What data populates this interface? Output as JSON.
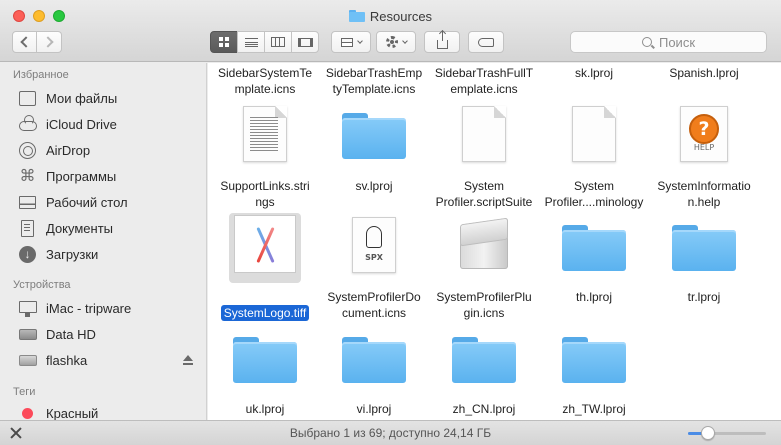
{
  "window": {
    "title": "Resources"
  },
  "toolbar": {
    "search_placeholder": "Поиск",
    "view_modes": [
      "icon-view",
      "list-view",
      "column-view",
      "cover-flow"
    ],
    "active_view": "icon-view"
  },
  "sidebar": {
    "favorites_header": "Избранное",
    "favorites": [
      {
        "label": "Мои файлы",
        "icon": "all-my-files-icon"
      },
      {
        "label": "iCloud Drive",
        "icon": "cloud-icon"
      },
      {
        "label": "AirDrop",
        "icon": "airdrop-icon"
      },
      {
        "label": "Программы",
        "icon": "applications-icon"
      },
      {
        "label": "Рабочий стол",
        "icon": "desktop-icon"
      },
      {
        "label": "Документы",
        "icon": "documents-icon"
      },
      {
        "label": "Загрузки",
        "icon": "downloads-icon"
      }
    ],
    "devices_header": "Устройства",
    "devices": [
      {
        "label": "iMac - tripware",
        "icon": "imac-icon"
      },
      {
        "label": "Data HD",
        "icon": "hard-drive-icon"
      },
      {
        "label": "flashka",
        "icon": "flash-drive-icon",
        "ejectable": true
      }
    ],
    "tags_header": "Теги",
    "tags": [
      {
        "label": "Красный",
        "color": "#fc4a5a"
      }
    ]
  },
  "files": [
    {
      "name": "SidebarSystemTe\nmplate.icns",
      "kind": "icns"
    },
    {
      "name": "SidebarTrashEmp\ntyTemplate.icns",
      "kind": "icns"
    },
    {
      "name": "SidebarTrashFullT\nemplate.icns",
      "kind": "icns"
    },
    {
      "name": "sk.lproj",
      "kind": "folder"
    },
    {
      "name": "Spanish.lproj",
      "kind": "folder"
    },
    {
      "name": "SupportLinks.stri\nngs",
      "kind": "strings"
    },
    {
      "name": "sv.lproj",
      "kind": "folder"
    },
    {
      "name": "System\nProfiler.scriptSuite",
      "kind": "document"
    },
    {
      "name": "System\nProfiler....minology",
      "kind": "document"
    },
    {
      "name": "SystemInformatio\nn.help",
      "kind": "help"
    },
    {
      "name": "SystemLogo.tiff",
      "kind": "tiff",
      "selected": true
    },
    {
      "name": "SystemProfilerDo\ncument.icns",
      "kind": "spx"
    },
    {
      "name": "SystemProfilerPlu\ngin.icns",
      "kind": "plugin"
    },
    {
      "name": "th.lproj",
      "kind": "folder"
    },
    {
      "name": "tr.lproj",
      "kind": "folder"
    },
    {
      "name": "uk.lproj",
      "kind": "folder"
    },
    {
      "name": "vi.lproj",
      "kind": "folder"
    },
    {
      "name": "zh_CN.lproj",
      "kind": "folder"
    },
    {
      "name": "zh_TW.lproj",
      "kind": "folder"
    }
  ],
  "status": {
    "text": "Выбрано 1 из 69; доступно 24,14 ГБ",
    "icon_size_level": 0.25
  },
  "colors": {
    "selection": "#1b67d6",
    "folder": "#6fc0f6",
    "tag_red": "#fc4a5a"
  }
}
